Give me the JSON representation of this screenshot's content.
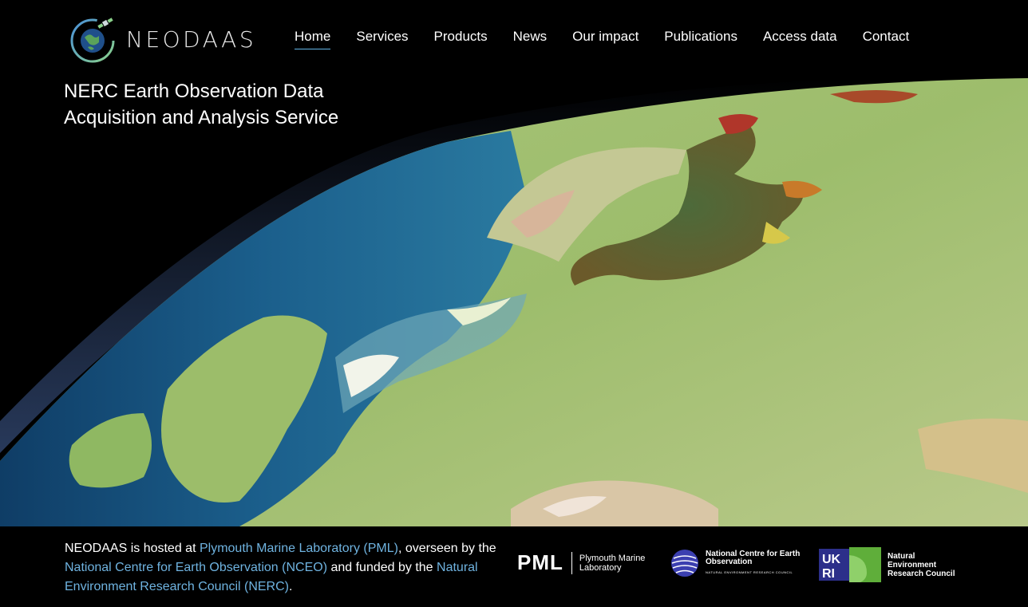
{
  "header": {
    "logo_text": "NEODAAS",
    "logo_icon": "globe-satellite-icon",
    "nav": [
      {
        "label": "Home",
        "active": true
      },
      {
        "label": "Services",
        "active": false
      },
      {
        "label": "Products",
        "active": false
      },
      {
        "label": "News",
        "active": false
      },
      {
        "label": "Our impact",
        "active": false
      },
      {
        "label": "Publications",
        "active": false
      },
      {
        "label": "Access data",
        "active": false
      },
      {
        "label": "Contact",
        "active": false
      }
    ],
    "active_color": "#63b6e6"
  },
  "hero": {
    "title": "NERC Earth Observation Data Acquisition and Analysis Service"
  },
  "footer": {
    "text_1": "NEODAAS is hosted at ",
    "link_pml": "Plymouth Marine Laboratory (PML)",
    "text_2": ", overseen by the ",
    "link_nceo": "National Centre for Earth Observation (NCEO)",
    "text_3": " and funded by the ",
    "link_nerc": "Natural Environment Research Council (NERC)",
    "text_4": ".",
    "link_color": "#6fb3e0",
    "partners": {
      "pml_mark": "PML",
      "pml_name": "Plymouth Marine Laboratory",
      "nceo_name": "National Centre for Earth Observation",
      "nceo_sub": "NATURAL ENVIRONMENT RESEARCH COUNCIL",
      "ukri_name": "Natural Environment Research Council"
    }
  }
}
